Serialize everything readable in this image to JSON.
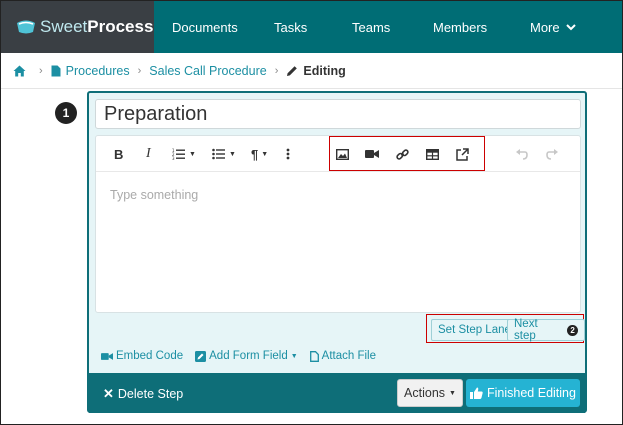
{
  "brand": {
    "sweet": "Sweet",
    "process": "Process"
  },
  "nav": {
    "documents": "Documents",
    "tasks": "Tasks",
    "teams": "Teams",
    "members": "Members",
    "more": "More"
  },
  "breadcrumb": {
    "procedures": "Procedures",
    "procedure_name": "Sales Call Procedure",
    "current": "Editing"
  },
  "step": {
    "number": "1",
    "title_value": "Preparation",
    "editor_placeholder": "Type something",
    "set_step_lane": "Set Step Lane",
    "next_step": "Next step",
    "next_step_badge": "2",
    "embed_code": "Embed Code",
    "add_form_field": "Add Form Field",
    "attach_file": "Attach File",
    "delete_step": "Delete Step",
    "actions": "Actions",
    "finished_editing": "Finished Editing"
  },
  "toolbar": {
    "bold": "B",
    "italic": "I",
    "paragraph": "¶"
  },
  "colors": {
    "nav_bg": "#006d75",
    "logo_bg": "#3a3f44",
    "link": "#1c8fa3",
    "card_footer": "#0e6e78",
    "primary_button": "#25b3d3",
    "highlight": "#cc0000"
  }
}
